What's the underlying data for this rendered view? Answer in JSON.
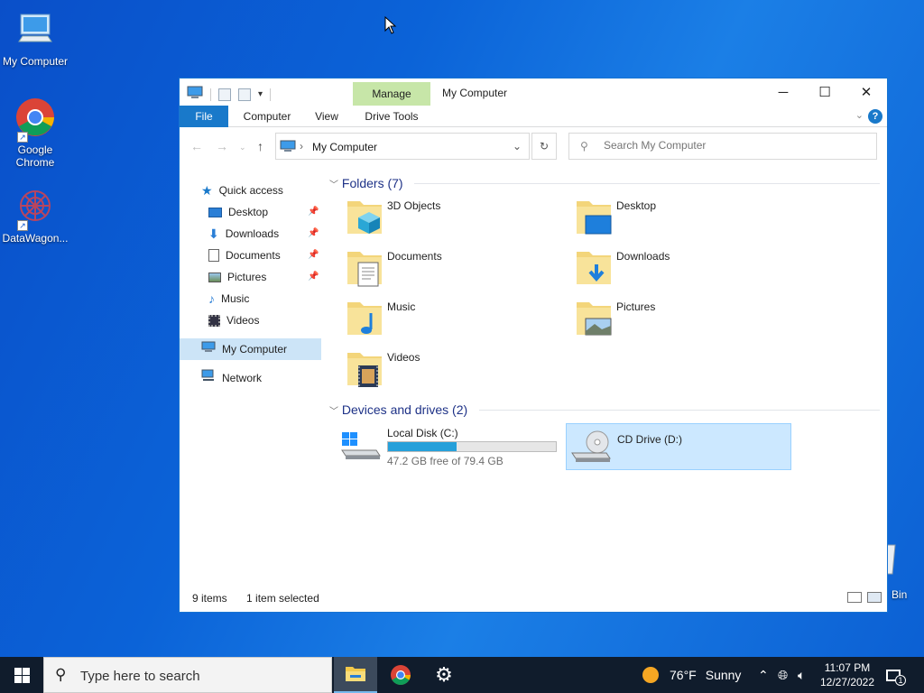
{
  "desktop": {
    "icons": [
      {
        "label": "My Computer"
      },
      {
        "label": "Google Chrome"
      },
      {
        "label": "DataWagon..."
      }
    ],
    "recycle_label": "Bin"
  },
  "window": {
    "title": "My Computer",
    "contextual_tab": "Manage",
    "tabs": [
      "File",
      "Computer",
      "View",
      "Drive Tools"
    ],
    "address": "My Computer",
    "search_placeholder": "Search My Computer"
  },
  "nav_pane": {
    "items": [
      {
        "label": "Quick access",
        "icon": "star-icon"
      },
      {
        "label": "Desktop",
        "icon": "desktop-folder-icon",
        "pinned": true
      },
      {
        "label": "Downloads",
        "icon": "download-arrow-icon",
        "pinned": true
      },
      {
        "label": "Documents",
        "icon": "document-icon",
        "pinned": true
      },
      {
        "label": "Pictures",
        "icon": "picture-icon",
        "pinned": true
      },
      {
        "label": "Music",
        "icon": "music-note-icon"
      },
      {
        "label": "Videos",
        "icon": "film-icon"
      },
      {
        "label": "My Computer",
        "icon": "computer-icon",
        "selected": true
      },
      {
        "label": "Network",
        "icon": "network-icon"
      }
    ]
  },
  "folders_group": {
    "label": "Folders (7)"
  },
  "folders": [
    {
      "label": "3D Objects",
      "icon": "3d-cube-icon"
    },
    {
      "label": "Desktop",
      "icon": "desktop-screen-icon"
    },
    {
      "label": "Documents",
      "icon": "document-icon"
    },
    {
      "label": "Downloads",
      "icon": "download-arrow-icon"
    },
    {
      "label": "Music",
      "icon": "music-note-icon"
    },
    {
      "label": "Pictures",
      "icon": "picture-icon"
    },
    {
      "label": "Videos",
      "icon": "film-icon"
    }
  ],
  "drives_group": {
    "label": "Devices and drives (2)"
  },
  "drives": [
    {
      "label": "Local Disk (C:)",
      "free_text": "47.2 GB free of 79.4 GB",
      "used_fraction": 0.41,
      "icon": "windows-drive-icon"
    },
    {
      "label": "CD Drive (D:)",
      "icon": "cd-drive-icon",
      "selected": true
    }
  ],
  "status": {
    "items": "9 items",
    "selected": "1 item selected"
  },
  "taskbar": {
    "search_placeholder": "Type here to search",
    "weather_temp": "76°F",
    "weather_text": "Sunny",
    "time": "11:07 PM",
    "date": "12/27/2022",
    "notification_count": "1"
  },
  "colors": {
    "accent": "#1979ca",
    "selection": "#cce8ff",
    "desktop": "#0b63d8",
    "taskbar": "#101c2c"
  }
}
